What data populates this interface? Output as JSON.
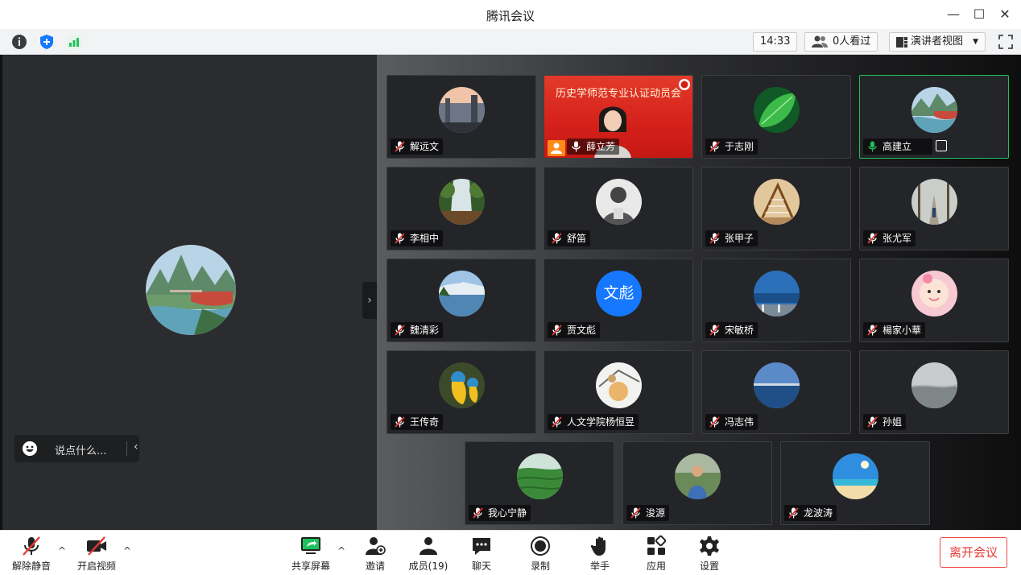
{
  "window": {
    "title": "腾讯会议",
    "minimize": "—",
    "maximize": "☐",
    "close": "✕"
  },
  "infobar": {
    "time": "14:33",
    "viewers": "0人看过",
    "view_mode": "演讲者视图",
    "icons": [
      "info-icon",
      "shield-icon",
      "signal-icon",
      "fullscreen-icon"
    ]
  },
  "chat": {
    "placeholder": "说点什么...",
    "collapse": "‹"
  },
  "gallery": {
    "expand": "›",
    "participants": [
      {
        "name": "解远文",
        "mic": "muted",
        "avatar": "city"
      },
      {
        "name": "薛立芳",
        "mic": "active",
        "video": true,
        "banner": "历史学师范专业认证动员会",
        "host": true
      },
      {
        "name": "于志刚",
        "mic": "muted",
        "avatar": "leaf"
      },
      {
        "name": "高建立",
        "mic": "on",
        "avatar": "river",
        "active": true
      },
      {
        "name": "李相中",
        "mic": "muted",
        "avatar": "waterfall"
      },
      {
        "name": "舒笛",
        "mic": "muted",
        "avatar": "portrait"
      },
      {
        "name": "张甲子",
        "mic": "muted",
        "avatar": "harp"
      },
      {
        "name": "张尤军",
        "mic": "muted",
        "avatar": "forest"
      },
      {
        "name": "魏清彩",
        "mic": "muted",
        "avatar": "lake"
      },
      {
        "name": "贾文彪",
        "mic": "muted",
        "avatar_text": "文彪"
      },
      {
        "name": "宋敏桥",
        "mic": "muted",
        "avatar": "sea"
      },
      {
        "name": "楊家小華",
        "mic": "muted",
        "avatar": "baby"
      },
      {
        "name": "王传奇",
        "mic": "muted",
        "avatar": "parrot"
      },
      {
        "name": "人文学院杨恒昱",
        "mic": "muted",
        "avatar": "food"
      },
      {
        "name": "冯志伟",
        "mic": "muted",
        "avatar": "sky"
      },
      {
        "name": "孙姐",
        "mic": "muted",
        "avatar": "fog"
      },
      {
        "name": "我心宁静",
        "mic": "muted",
        "avatar": "tea"
      },
      {
        "name": "浚源",
        "mic": "muted",
        "avatar": "man"
      },
      {
        "name": "龙波涛",
        "mic": "muted",
        "avatar": "beach"
      }
    ]
  },
  "toolbar": {
    "unmute": "解除静音",
    "start_video": "开启视频",
    "share_screen": "共享屏幕",
    "invite": "邀请",
    "members": "成员(19)",
    "chat": "聊天",
    "record": "录制",
    "raise_hand": "举手",
    "apps": "应用",
    "settings": "设置",
    "leave": "离开会议",
    "caret": "^"
  },
  "colors": {
    "active_border": "#1ec25c",
    "leave_red": "#e53935",
    "text_avatar_blue": "#1677ff",
    "host_orange": "#ff8a1a"
  }
}
